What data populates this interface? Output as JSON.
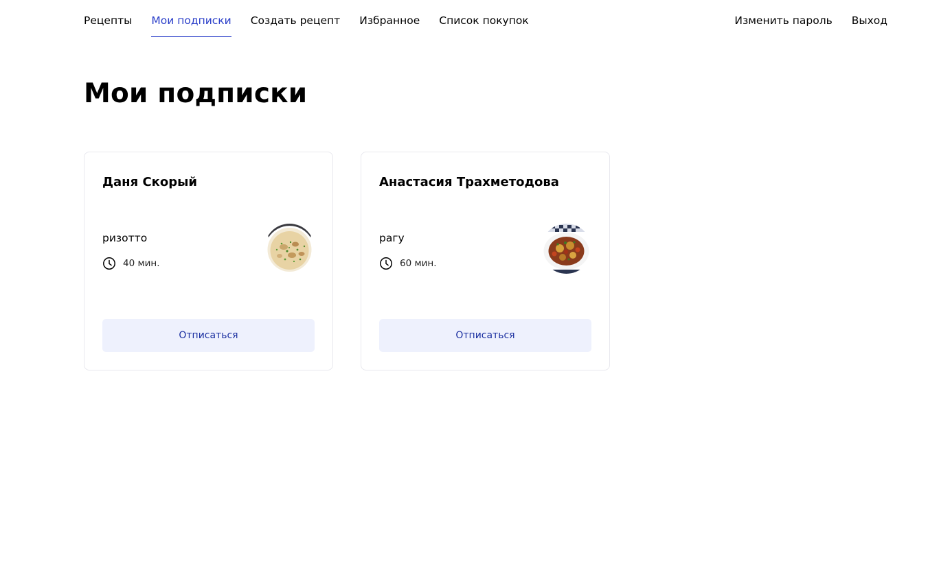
{
  "nav": {
    "recipes": "Рецепты",
    "subscriptions": "Мои подписки",
    "create_recipe": "Создать рецепт",
    "favorites": "Избранное",
    "shopping_list": "Список покупок",
    "change_password": "Изменить пароль",
    "logout": "Выход",
    "active_color": "#2a3ec9"
  },
  "page": {
    "title": "Мои подписки"
  },
  "subscriptions": [
    {
      "author": "Даня Скорый",
      "recipe_name": "ризотто",
      "cook_time": "40 мин.",
      "image_icon": "risotto-dish-image",
      "unsubscribe_label": "Отписаться"
    },
    {
      "author": "Анастасия Трахметодова",
      "recipe_name": "рагу",
      "cook_time": "60 мин.",
      "image_icon": "ragout-dish-image",
      "unsubscribe_label": "Отписаться"
    }
  ],
  "colors": {
    "button_bg": "#eef1fd",
    "button_text": "#1a2fa0",
    "card_border": "#e8e8ee"
  }
}
